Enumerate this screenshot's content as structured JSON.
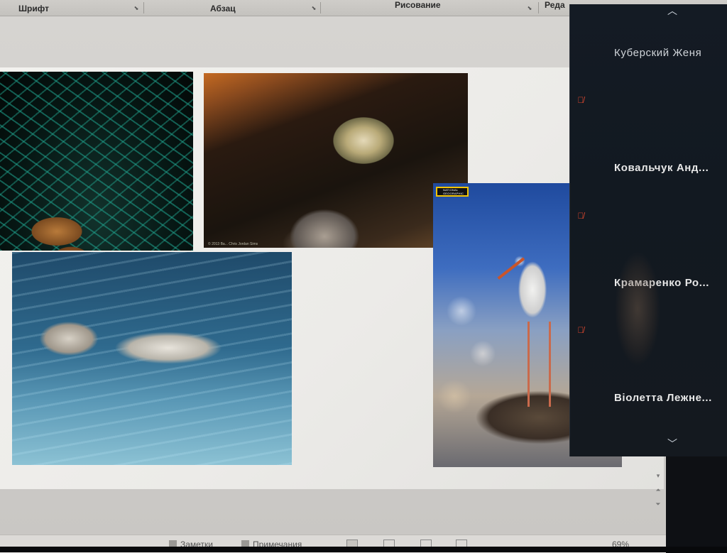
{
  "ribbon": {
    "groups": [
      {
        "label": "Шрифт"
      },
      {
        "label": "Абзац"
      },
      {
        "label": "Рисование"
      },
      {
        "label": "Реда"
      }
    ]
  },
  "slide": {
    "stork_photo": {
      "logo_line1": "NATIONAL",
      "logo_line2": "GEOGRAPHIC"
    },
    "bird_photo": {
      "caption": "© 2013 Ba... Chris Jordan Sims"
    }
  },
  "statusbar": {
    "notes_label": "Заметки",
    "comments_label": "Примечания",
    "zoom_text": "69%"
  },
  "participants": {
    "up_icon": "chevron-up-icon",
    "down_icon": "chevron-down-icon",
    "muted_icon": "mic-muted-icon",
    "mute_color": "#e0482e",
    "items": [
      {
        "name": "Куберский Женя",
        "muted": false
      },
      {
        "name": "Ковальчук Анд...",
        "muted": true
      },
      {
        "name": "Крамаренко Ро...",
        "muted": true
      },
      {
        "name": "Віолетта Лежне...",
        "muted": true
      }
    ]
  }
}
